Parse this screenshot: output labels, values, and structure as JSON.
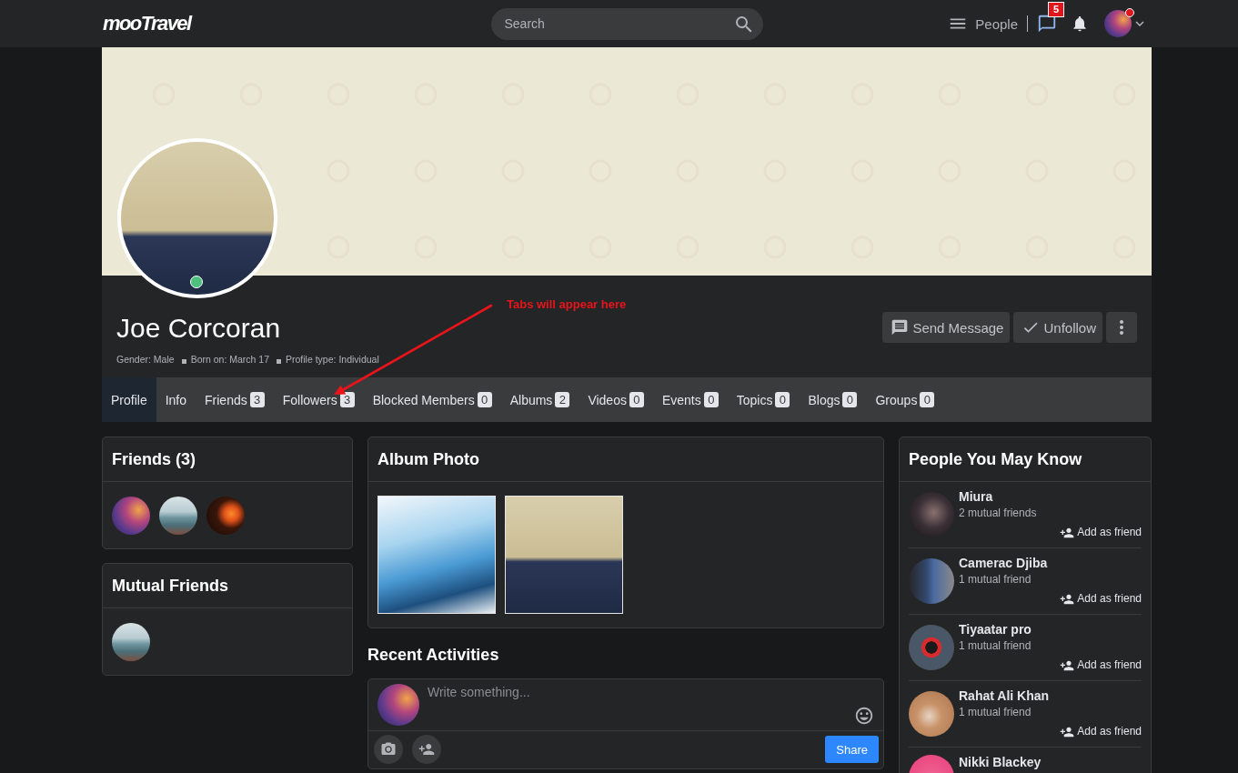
{
  "topbar": {
    "logo": "mooTravel",
    "search": {
      "placeholder": "Search"
    },
    "menu_label": "People",
    "messages_count": "5",
    "avatar_dot": true
  },
  "profile": {
    "name": "Joe Corcoran",
    "online": true,
    "meta": [
      "Gender: Male",
      "Born on: March 17",
      "Profile type: Individual"
    ],
    "actions": [
      {
        "kind": "message",
        "label": "Send Message"
      },
      {
        "kind": "unfollow",
        "label": "Unfollow"
      },
      {
        "kind": "more"
      }
    ]
  },
  "annotation": {
    "text": "Tabs will appear here"
  },
  "tabs": [
    {
      "label": "Profile",
      "selected": true
    },
    {
      "label": "Info",
      "selected": false
    },
    {
      "label": "Friends",
      "count": "3",
      "selected": false
    },
    {
      "label": "Followers",
      "count": "3",
      "selected": false
    },
    {
      "label": "Blocked Members",
      "count": "0",
      "selected": false
    },
    {
      "label": "Albums",
      "count": "2",
      "selected": false
    },
    {
      "label": "Videos",
      "count": "0",
      "selected": false
    },
    {
      "label": "Events",
      "count": "0",
      "selected": false
    },
    {
      "label": "Topics",
      "count": "0",
      "selected": false
    },
    {
      "label": "Blogs",
      "count": "0",
      "selected": false
    },
    {
      "label": "Groups",
      "count": "0",
      "selected": false
    }
  ],
  "friends": {
    "title": "Friends (3)"
  },
  "mutual_friends": {
    "title": "Mutual Friends"
  },
  "album": {
    "title": "Album Photo"
  },
  "recent_activities": {
    "title": "Recent Activities",
    "composer": {
      "placeholder": "Write something...",
      "button": "Share"
    }
  },
  "people_you_may_know": {
    "title": "People You May Know",
    "people": [
      {
        "name": "Miura",
        "mutual": "2 mutual friends",
        "action": "Add as friend"
      },
      {
        "name": "Camerac Djiba",
        "mutual": "1 mutual friend",
        "action": "Add as friend"
      },
      {
        "name": "Tiyaatar pro",
        "mutual": "1 mutual friend",
        "action": "Add as friend"
      },
      {
        "name": "Rahat Ali Khan",
        "mutual": "1 mutual friend",
        "action": "Add as friend"
      },
      {
        "name": "Nikki Blackey"
      }
    ]
  }
}
